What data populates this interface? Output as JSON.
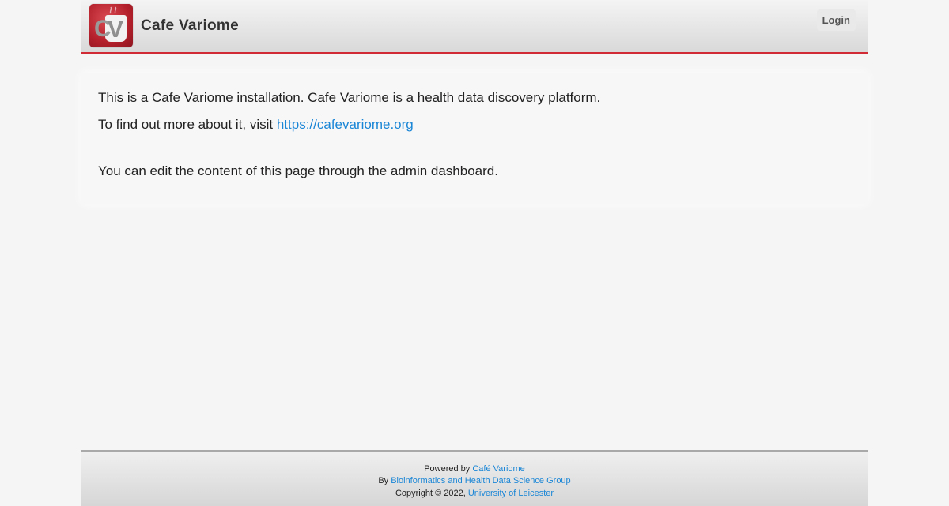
{
  "header": {
    "brand": "Cafe Variome",
    "logo_letters": {
      "c": "C",
      "v": "V"
    },
    "login_label": "Login"
  },
  "main": {
    "intro": "This is a Cafe Variome installation. Cafe Variome is a health data discovery platform.",
    "more_prefix": "To find out more about it, visit ",
    "more_link": "https://cafevariome.org",
    "edit_note": "You can edit the content of this page through the admin dashboard."
  },
  "footer": {
    "powered_prefix": "Powered by ",
    "powered_link": "Café Variome",
    "by_prefix": "By ",
    "by_link": "Bioinformatics and Health Data Science Group",
    "copyright_prefix": "Copyright © 2022, ",
    "copyright_link": "University of Leicester"
  },
  "colors": {
    "accent": "#d12b36",
    "link": "#1a86d6",
    "logo_red": "#b3202b"
  },
  "icons": {
    "logo": "cafe-variome-logo"
  }
}
